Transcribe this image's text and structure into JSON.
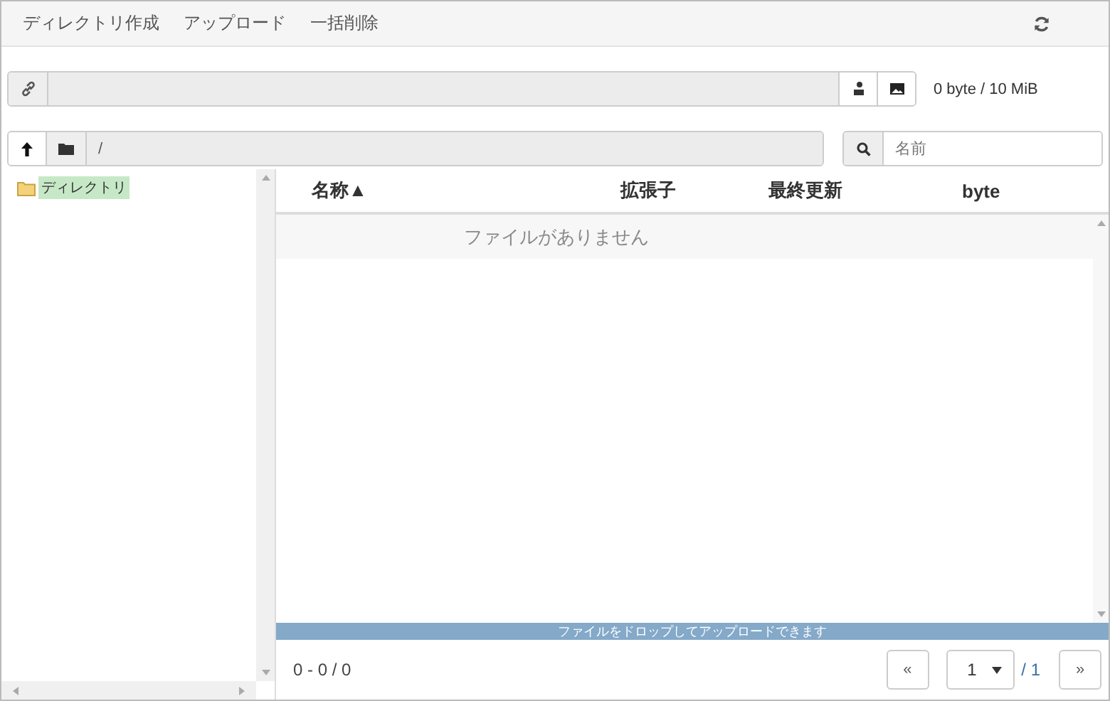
{
  "menu": [
    {
      "label": "ディレクトリ作成"
    },
    {
      "label": "アップロード"
    },
    {
      "label": "一括削除"
    }
  ],
  "quota": "0 byte / 10 MiB",
  "path": "/",
  "search": {
    "placeholder": "名前"
  },
  "tree": [
    {
      "label": "ディレクトリ",
      "selected": true
    }
  ],
  "table": {
    "columns": [
      "名称▲",
      "拡張子",
      "最終更新",
      "byte"
    ],
    "empty_message": "ファイルがありません"
  },
  "drop_hint": "ファイルをドロップしてアップロードできます",
  "pager": {
    "range": "0 - 0 / 0",
    "first": "«",
    "page": "1",
    "total": "/ 1",
    "last": "»"
  }
}
